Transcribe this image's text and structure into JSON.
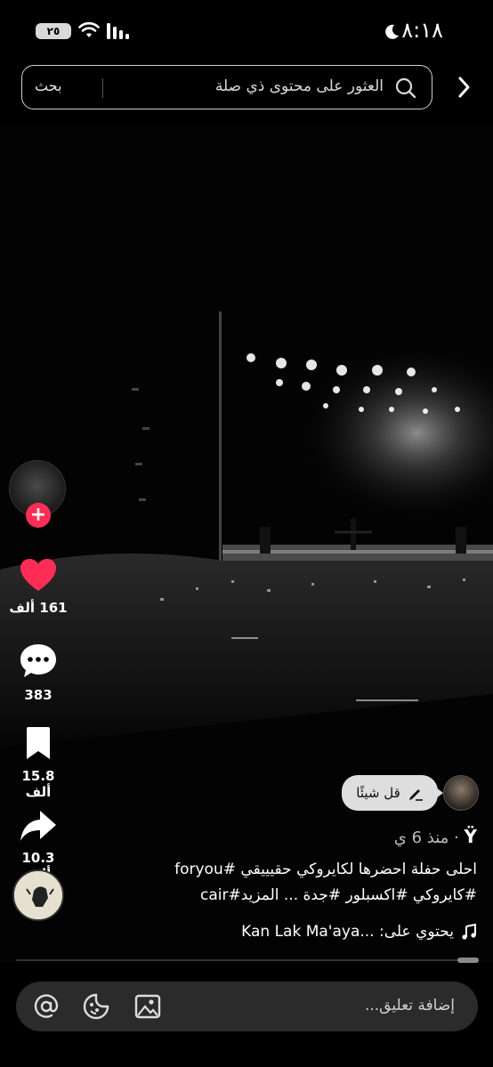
{
  "status": {
    "battery": "٢٥",
    "time": "٨:١٨"
  },
  "search": {
    "placeholder": "العثور على محتوى ذي صلة",
    "button_label": "بحث"
  },
  "actions": {
    "likes": "161 ألف",
    "comments": "383",
    "saves": "15.8 ألف",
    "shares": "10.3 ألف"
  },
  "comment_prompt": {
    "label": "قل شيئًا"
  },
  "post": {
    "username": "Ÿ",
    "separator": "·",
    "time_ago": "منذ 6 ي",
    "caption_line1": "احلى حفلة احضرها لكايروكي حقيييقي #foryou",
    "caption_line2": "#كايروكي #اكسبلور #جدة ... المزيد#cair",
    "sound": "يحتوي على: ...Kan Lak Ma'aya"
  },
  "comment_bar": {
    "placeholder": "إضافة تعليق..."
  },
  "colors": {
    "like": "#ff2d55",
    "background": "#000000"
  }
}
